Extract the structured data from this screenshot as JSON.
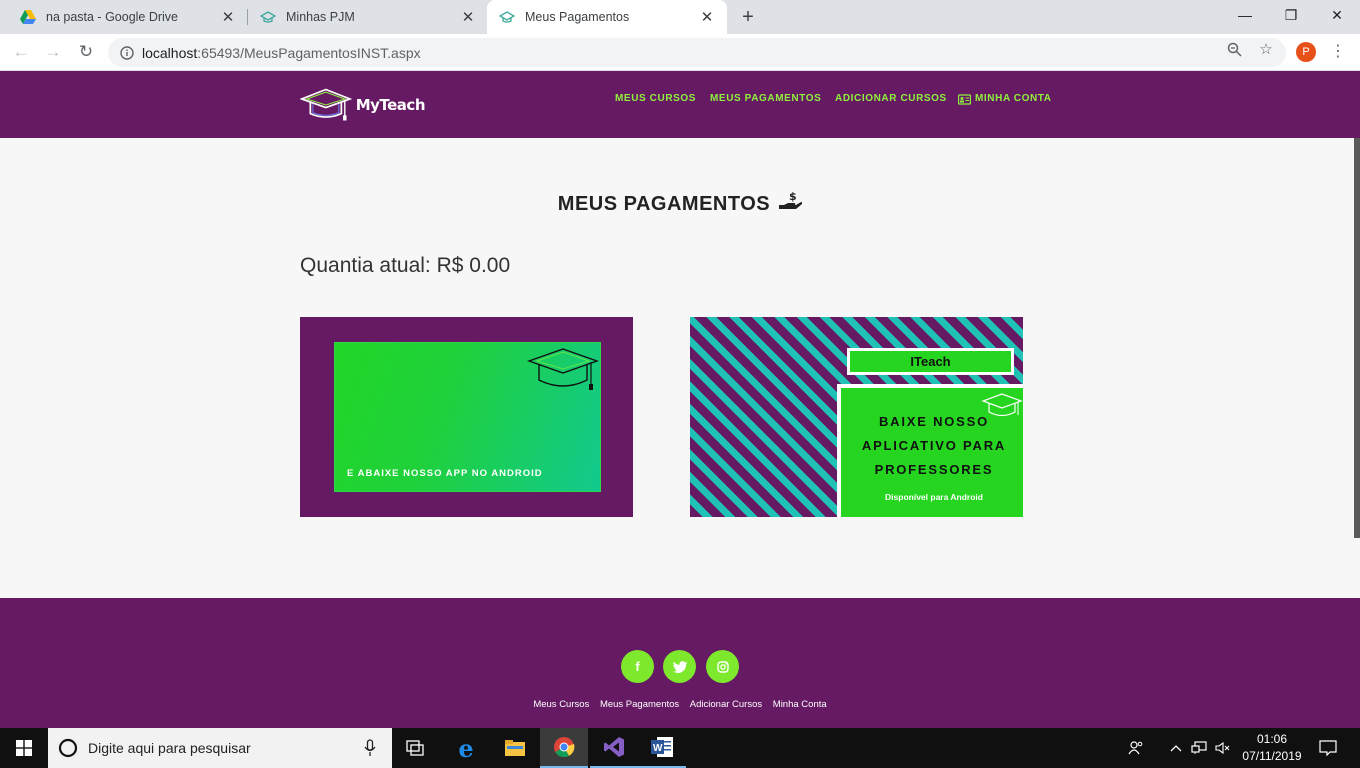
{
  "tabs": [
    {
      "title": "na pasta - Google Drive"
    },
    {
      "title": "Minhas PJM"
    },
    {
      "title": "Meus Pagamentos"
    }
  ],
  "omnibox": {
    "host": "localhost",
    "path": ":65493/MeusPagamentosINST.aspx"
  },
  "profile": {
    "initial": "P"
  },
  "site": {
    "logo_text": "MyTeach",
    "nav": [
      "MEUS CURSOS",
      "MEUS PAGAMENTOS",
      "ADICIONAR CURSOS",
      "MINHA CONTA"
    ]
  },
  "page": {
    "title": "MEUS PAGAMENTOS",
    "amount": "Quantia atual: R$ 0.00"
  },
  "banner1": {
    "text": "E ABAIXE NOSSO APP NO ANDROID"
  },
  "banner2": {
    "brand": "ITeach",
    "line1": "BAIXE NOSSO",
    "line2": "APLICATIVO PARA",
    "line3": "PROFESSORES",
    "sub": "Disponível para Android"
  },
  "footer": {
    "social": [
      "facebook-icon",
      "twitter-icon",
      "instagram-icon"
    ],
    "links": [
      "Meus Cursos",
      "Meus Pagamentos",
      "Adicionar Cursos",
      "Minha Conta"
    ]
  },
  "taskbar": {
    "search_placeholder": "Digite aqui para pesquisar",
    "time": "01:06",
    "date": "07/11/2019"
  },
  "colors": {
    "brand_purple": "#651a63",
    "accent_green": "#8ef23c",
    "banner_green": "#25d51f"
  }
}
